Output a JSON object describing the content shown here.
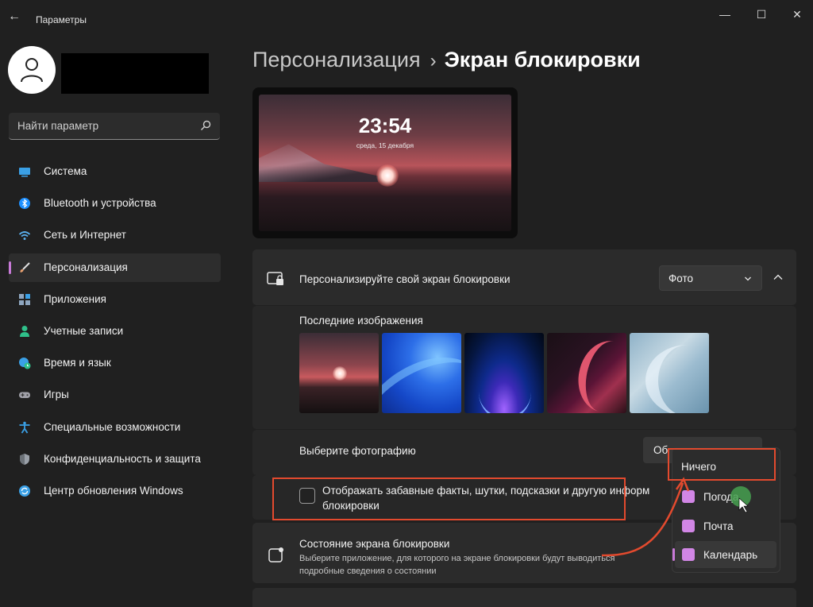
{
  "window": {
    "title": "Параметры",
    "back_symbol": "←",
    "minimize_symbol": "—",
    "maximize_symbol": "☐",
    "close_symbol": "✕"
  },
  "search": {
    "placeholder": "Найти параметр",
    "icon": "search-icon"
  },
  "sidebar": {
    "items": [
      {
        "label": "Система",
        "icon": "display-icon",
        "color": "#3aa0e6"
      },
      {
        "label": "Bluetooth и устройства",
        "icon": "bluetooth-icon",
        "color": "#1e90ff"
      },
      {
        "label": "Сеть и Интернет",
        "icon": "wifi-icon",
        "color": "#5ab0ee"
      },
      {
        "label": "Персонализация",
        "icon": "brush-icon",
        "color": "#e8a070",
        "active": true
      },
      {
        "label": "Приложения",
        "icon": "apps-icon",
        "color": "#8ea6c0"
      },
      {
        "label": "Учетные записи",
        "icon": "person-icon",
        "color": "#2fc08a"
      },
      {
        "label": "Время и язык",
        "icon": "globe-clock-icon",
        "color": "#3aa0e6"
      },
      {
        "label": "Игры",
        "icon": "gamepad-icon",
        "color": "#a0a0a8"
      },
      {
        "label": "Специальные возможности",
        "icon": "accessibility-icon",
        "color": "#3aa0e6"
      },
      {
        "label": "Конфиденциальность и защита",
        "icon": "shield-icon",
        "color": "#9aa0a8"
      },
      {
        "label": "Центр обновления Windows",
        "icon": "update-icon",
        "color": "#3aa0e6"
      }
    ]
  },
  "breadcrumb": {
    "parent": "Персонализация",
    "separator": "›",
    "current": "Экран блокировки"
  },
  "preview": {
    "time": "23:54",
    "date": "среда, 15 декабря"
  },
  "personalize": {
    "label": "Персонализируйте свой экран блокировки",
    "dropdown_value": "Фото"
  },
  "recent": {
    "label": "Последние изображения"
  },
  "choose_photo": {
    "label": "Выберите фотографию",
    "button_label": "Об"
  },
  "fun_facts": {
    "label": "Отображать забавные факты, шутки, подсказки и другую информ",
    "label_line2": "блокировки",
    "checked": false
  },
  "lock_status": {
    "title": "Состояние экрана блокировки",
    "description": "Выберите приложение, для которого на экране блокировки будут выводиться подробные сведения о состоянии"
  },
  "status_menu": {
    "items": [
      {
        "label": "Ничего"
      },
      {
        "label": "Погода",
        "icon": "weather-icon"
      },
      {
        "label": "Почта",
        "icon": "mail-icon"
      },
      {
        "label": "Календарь",
        "icon": "calendar-icon",
        "selected": true
      }
    ]
  },
  "colors": {
    "accent": "#c87ad8",
    "annotation": "#e34a2e",
    "background": "#202020",
    "card": "#2b2b2b"
  }
}
